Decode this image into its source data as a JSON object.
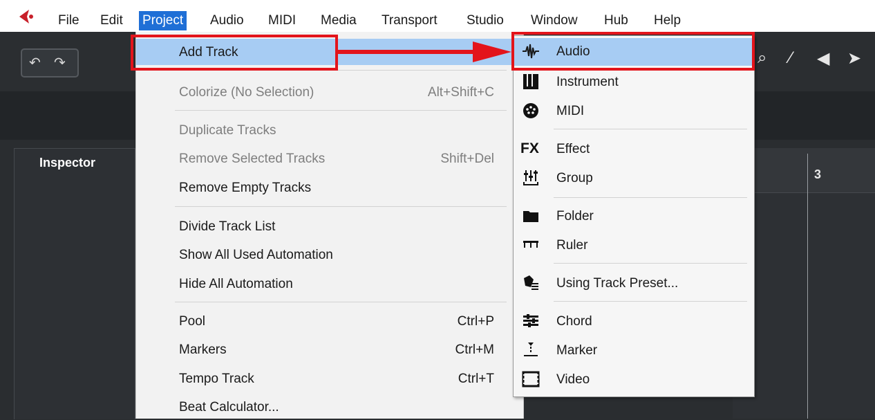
{
  "menubar": {
    "items": [
      "File",
      "Edit",
      "Project",
      "Audio",
      "MIDI",
      "Media",
      "Transport",
      "Studio",
      "Window",
      "Hub",
      "Help"
    ],
    "active": "Project"
  },
  "toolbar": {
    "undo_icon": "undo-icon",
    "redo_icon": "redo-icon"
  },
  "inspector": {
    "title": "Inspector"
  },
  "ruler": {
    "bar": "3"
  },
  "project_menu": {
    "items": [
      {
        "label": "Add Track",
        "shortcut": "",
        "disabled": false,
        "highlight": true
      },
      {
        "label": "Colorize (No Selection)",
        "shortcut": "Alt+Shift+C",
        "disabled": true
      },
      {
        "label": "Duplicate Tracks",
        "shortcut": "",
        "disabled": true
      },
      {
        "label": "Remove Selected Tracks",
        "shortcut": "Shift+Del",
        "disabled": true
      },
      {
        "label": "Remove Empty Tracks",
        "shortcut": "",
        "disabled": false
      },
      {
        "label": "Divide Track List",
        "shortcut": "",
        "disabled": false
      },
      {
        "label": "Show All Used Automation",
        "shortcut": "",
        "disabled": false
      },
      {
        "label": "Hide All Automation",
        "shortcut": "",
        "disabled": false
      },
      {
        "label": "Pool",
        "shortcut": "Ctrl+P",
        "disabled": false
      },
      {
        "label": "Markers",
        "shortcut": "Ctrl+M",
        "disabled": false
      },
      {
        "label": "Tempo Track",
        "shortcut": "Ctrl+T",
        "disabled": false
      },
      {
        "label": "Beat Calculator...",
        "shortcut": "",
        "disabled": false
      }
    ]
  },
  "add_track_submenu": {
    "items": [
      {
        "label": "Audio",
        "icon": "audio-waveform-icon",
        "highlight": true
      },
      {
        "label": "Instrument",
        "icon": "instrument-keys-icon"
      },
      {
        "label": "MIDI",
        "icon": "midi-port-icon"
      },
      {
        "label": "Effect",
        "icon": "fx-icon",
        "icon_text": "FX"
      },
      {
        "label": "Group",
        "icon": "group-faders-icon"
      },
      {
        "label": "Folder",
        "icon": "folder-icon"
      },
      {
        "label": "Ruler",
        "icon": "ruler-icon"
      },
      {
        "label": "Using Track Preset...",
        "icon": "track-preset-icon"
      },
      {
        "label": "Chord",
        "icon": "chord-icon"
      },
      {
        "label": "Marker",
        "icon": "marker-icon"
      },
      {
        "label": "Video",
        "icon": "video-icon"
      }
    ]
  },
  "colors": {
    "highlight": "#a7ccf3",
    "menu_active": "#1f6fd6",
    "annotation_red": "#e3141b",
    "logo_red": "#c8202a"
  }
}
